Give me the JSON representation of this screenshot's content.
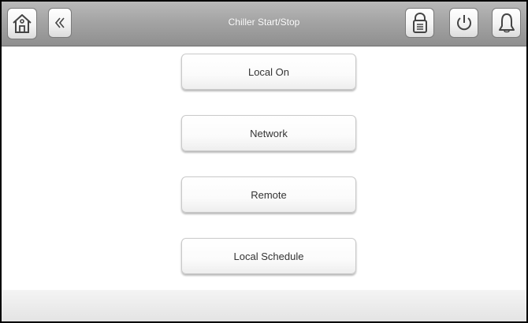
{
  "header": {
    "title": "Chiller Start/Stop",
    "left_icons": [
      "home-icon",
      "back-chevron-icon"
    ],
    "right_icons": [
      "lock-icon",
      "power-icon",
      "bell-icon"
    ]
  },
  "menu": {
    "items": [
      {
        "label": "Local On"
      },
      {
        "label": "Network"
      },
      {
        "label": "Remote"
      },
      {
        "label": "Local Schedule"
      }
    ]
  },
  "colors": {
    "header_top": "#b9b9b9",
    "header_bottom": "#8f8f8f",
    "button_text": "#333333",
    "border": "#000000"
  }
}
